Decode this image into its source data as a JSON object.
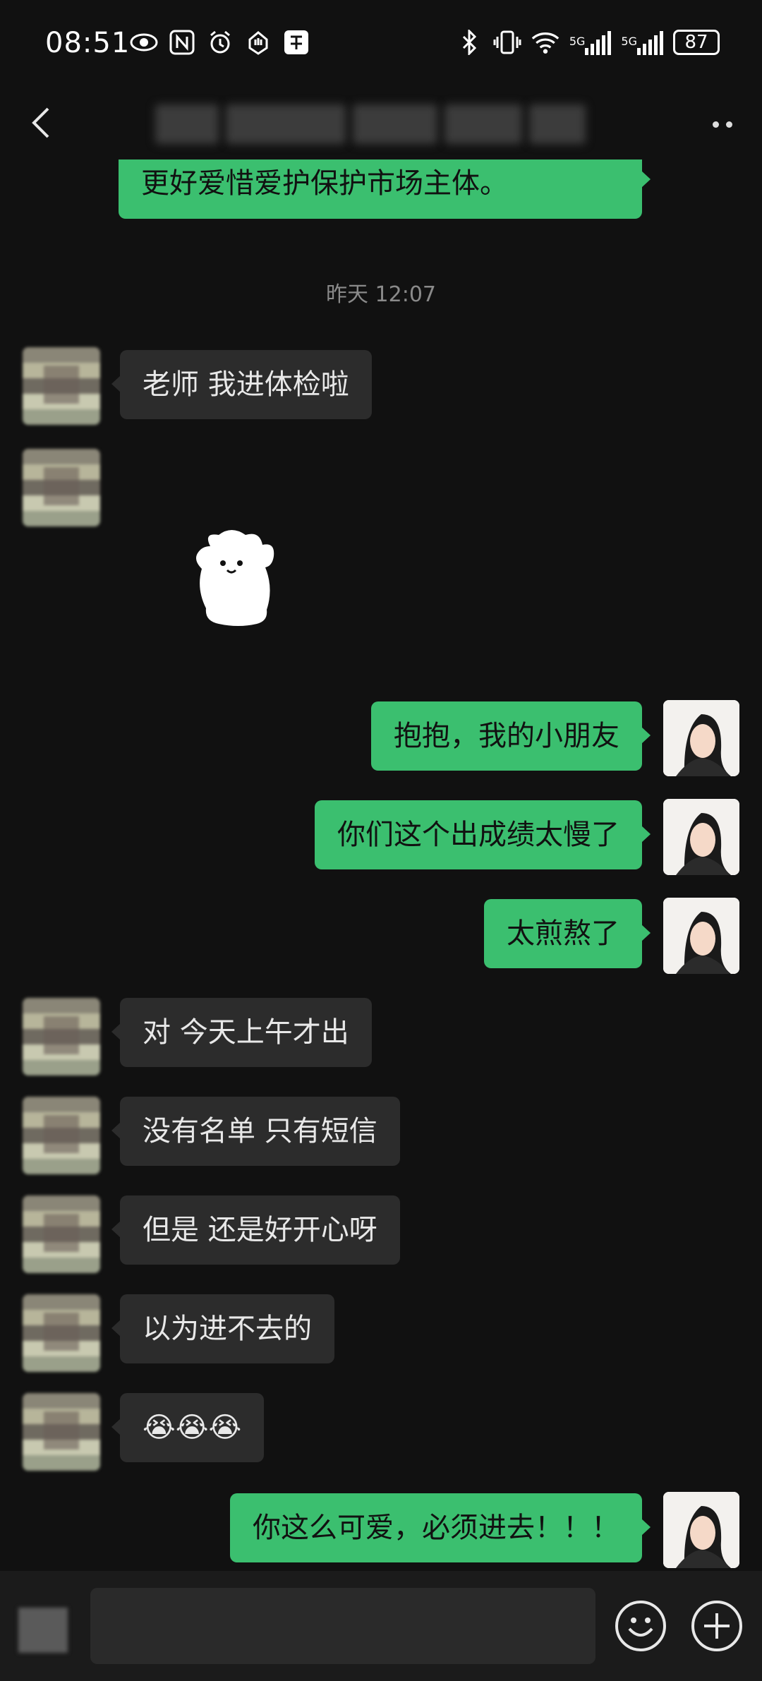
{
  "status_bar": {
    "time": "08:51",
    "left_icons": [
      "eye-icon",
      "nfc-icon",
      "alarm-icon",
      "hand-icon",
      "app-icon"
    ],
    "right_icons": [
      "bluetooth-icon",
      "vibrate-icon",
      "wifi-icon",
      "signal-5g-icon",
      "signal-5g-icon"
    ],
    "network_label": "5G",
    "battery": "87"
  },
  "header": {
    "title": "",
    "back_icon": "chevron-left-icon",
    "more_icon": "more-icon"
  },
  "messages": {
    "m0": "更好爱惜爱护保护市场主体。",
    "timestamp": "昨天 12:07",
    "m1": "老师 我进体检啦",
    "m3": "抱抱，我的小朋友",
    "m4": "你们这个出成绩太慢了",
    "m5": "太煎熬了",
    "m6": "对 今天上午才出",
    "m7": "没有名单 只有短信",
    "m8": "但是 还是好开心呀",
    "m9": "以为进不去的",
    "m10": "😭😭😭",
    "m11": "你这么可爱，必须进去！！！"
  },
  "input_bar": {
    "placeholder": "",
    "voice_icon": "voice-icon",
    "emoji_icon": "emoji-icon",
    "plus_icon": "plus-icon"
  },
  "colors": {
    "background": "#111111",
    "incoming_bubble": "#2c2c2c",
    "outgoing_bubble": "#3bbf6f"
  }
}
